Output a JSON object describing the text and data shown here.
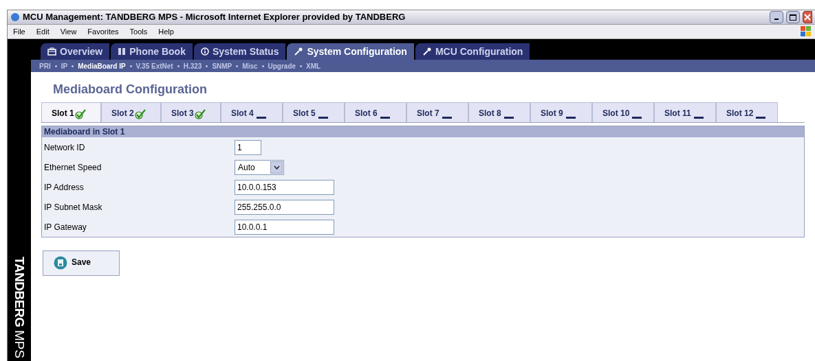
{
  "window": {
    "title": "MCU Management: TANDBERG MPS - Microsoft Internet Explorer provided by TANDBERG"
  },
  "menu": [
    "File",
    "Edit",
    "View",
    "Favorites",
    "Tools",
    "Help"
  ],
  "brand": {
    "name": "TANDBERG",
    "product": "MPS"
  },
  "main_tabs": [
    {
      "label": "Overview",
      "kind": "briefcase",
      "selected": false
    },
    {
      "label": "Phone Book",
      "kind": "book",
      "selected": false
    },
    {
      "label": "System Status",
      "kind": "info",
      "selected": false
    },
    {
      "label": "System Configuration",
      "kind": "wrench",
      "selected": true
    },
    {
      "label": "MCU Configuration",
      "kind": "wrench",
      "selected": false
    }
  ],
  "sub_nav": [
    {
      "label": "PRI",
      "selected": false
    },
    {
      "label": "IP",
      "selected": false
    },
    {
      "label": "MediaBoard IP",
      "selected": true
    },
    {
      "label": "V.35 ExtNet",
      "selected": false
    },
    {
      "label": "H.323",
      "selected": false
    },
    {
      "label": "SNMP",
      "selected": false
    },
    {
      "label": "Misc",
      "selected": false
    },
    {
      "label": "Upgrade",
      "selected": false
    },
    {
      "label": "XML",
      "selected": false
    }
  ],
  "page_title": "Mediaboard Configuration",
  "slot_tabs": [
    {
      "label": "Slot 1",
      "kind": "ok",
      "selected": true
    },
    {
      "label": "Slot 2",
      "kind": "ok",
      "selected": false
    },
    {
      "label": "Slot 3",
      "kind": "ok",
      "selected": false
    },
    {
      "label": "Slot 4",
      "kind": "empty",
      "selected": false
    },
    {
      "label": "Slot 5",
      "kind": "empty",
      "selected": false
    },
    {
      "label": "Slot 6",
      "kind": "empty",
      "selected": false
    },
    {
      "label": "Slot 7",
      "kind": "empty",
      "selected": false
    },
    {
      "label": "Slot 8",
      "kind": "empty",
      "selected": false
    },
    {
      "label": "Slot 9",
      "kind": "empty",
      "selected": false
    },
    {
      "label": "Slot 10",
      "kind": "empty",
      "selected": false
    },
    {
      "label": "Slot 11",
      "kind": "empty",
      "selected": false
    },
    {
      "label": "Slot 12",
      "kind": "empty",
      "selected": false
    }
  ],
  "panel": {
    "title": "Mediaboard in Slot 1",
    "fields": [
      {
        "label": "Network ID",
        "kind": "short",
        "value": "1"
      },
      {
        "label": "Ethernet Speed",
        "kind": "select",
        "value": "Auto"
      },
      {
        "label": "IP Address",
        "kind": "text",
        "value": "10.0.0.153"
      },
      {
        "label": "IP Subnet Mask",
        "kind": "text",
        "value": "255.255.0.0"
      },
      {
        "label": "IP Gateway",
        "kind": "text",
        "value": "10.0.0.1"
      }
    ]
  },
  "save_button": "Save"
}
